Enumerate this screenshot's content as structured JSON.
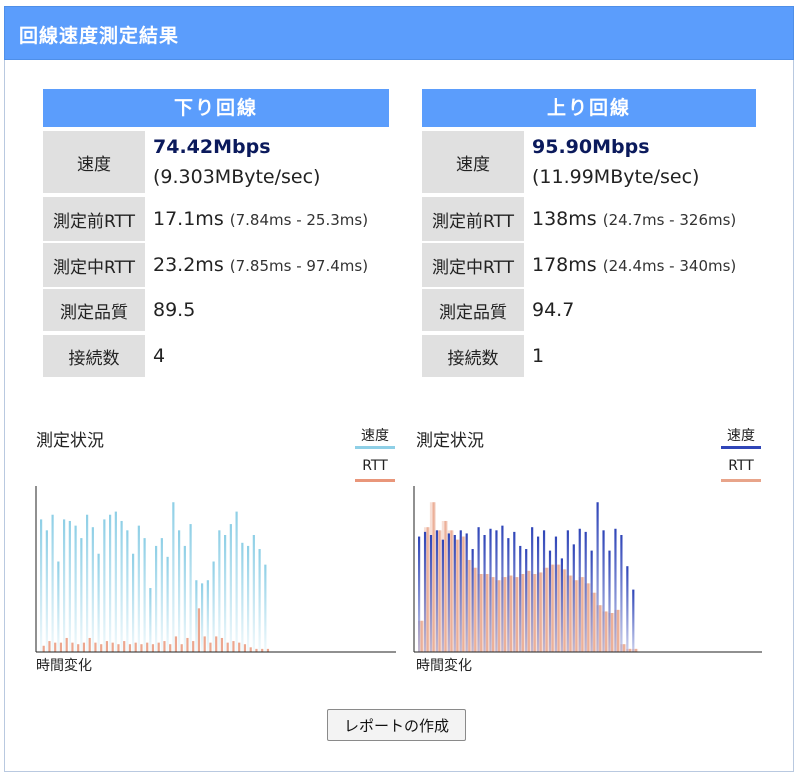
{
  "header": {
    "title": "回線速度測定結果"
  },
  "download": {
    "title": "下り回線",
    "speed_label": "速度",
    "speed_main": "74.42Mbps",
    "speed_sub": "(9.303MByte/sec)",
    "rtt_before_label": "測定前RTT",
    "rtt_before_value": "17.1ms",
    "rtt_before_range": "(7.84ms - 25.3ms)",
    "rtt_during_label": "測定中RTT",
    "rtt_during_value": "23.2ms",
    "rtt_during_range": "(7.85ms - 97.4ms)",
    "quality_label": "測定品質",
    "quality_value": "89.5",
    "connections_label": "接続数",
    "connections_value": "4"
  },
  "upload": {
    "title": "上り回線",
    "speed_label": "速度",
    "speed_main": "95.90Mbps",
    "speed_sub": "(11.99MByte/sec)",
    "rtt_before_label": "測定前RTT",
    "rtt_before_value": "138ms",
    "rtt_before_range": "(24.7ms - 326ms)",
    "rtt_during_label": "測定中RTT",
    "rtt_during_value": "178ms",
    "rtt_during_range": "(24.4ms - 340ms)",
    "quality_label": "測定品質",
    "quality_value": "94.7",
    "connections_label": "接続数",
    "connections_value": "1"
  },
  "charts": {
    "status_title": "測定状況",
    "legend_speed": "速度",
    "legend_rtt": "RTT",
    "x_label": "時間変化",
    "download_colors": {
      "speed": "#8ecfe6",
      "rtt": "#e9967a"
    },
    "upload_colors": {
      "speed": "#2f45b8",
      "rtt": "#e8a48a"
    }
  },
  "chart_data": [
    {
      "type": "bar",
      "xlabel": "時間変化",
      "ylim": [
        0,
        1
      ],
      "series": [
        {
          "name": "速度",
          "values": [
            0.85,
            0.78,
            0.88,
            0.58,
            0.85,
            0.84,
            0.81,
            0.73,
            0.88,
            0.8,
            0.63,
            0.85,
            0.88,
            0.9,
            0.84,
            0.78,
            0.63,
            0.81,
            0.73,
            0.41,
            0.68,
            0.73,
            0.61,
            0.96,
            0.78,
            0.68,
            0.82,
            0.46,
            0.44,
            0.46,
            0.58,
            0.78,
            0.75,
            0.82,
            0.9,
            0.7,
            0.68,
            0.75,
            0.66,
            0.56
          ]
        },
        {
          "name": "RTT",
          "values": [
            0.04,
            0.07,
            0.06,
            0.06,
            0.09,
            0.06,
            0.05,
            0.06,
            0.09,
            0.06,
            0.05,
            0.07,
            0.06,
            0.05,
            0.07,
            0.05,
            0.06,
            0.05,
            0.06,
            0.05,
            0.06,
            0.07,
            0.05,
            0.1,
            0.05,
            0.09,
            0.07,
            0.28,
            0.1,
            0.06,
            0.1,
            0.09,
            0.06,
            0.07,
            0.06,
            0.05,
            0.03,
            0.02,
            0.02,
            0.02
          ]
        }
      ]
    },
    {
      "type": "bar",
      "xlabel": "時間変化",
      "ylim": [
        0,
        1
      ],
      "series": [
        {
          "name": "速度",
          "values": [
            0.74,
            0.77,
            0.75,
            0.78,
            0.72,
            0.76,
            0.75,
            0.78,
            0.76,
            0.66,
            0.8,
            0.75,
            0.79,
            0.78,
            0.81,
            0.73,
            0.77,
            0.68,
            0.66,
            0.8,
            0.74,
            0.78,
            0.65,
            0.74,
            0.6,
            0.78,
            0.69,
            0.79,
            0.77,
            0.65,
            0.96,
            0.78,
            0.65,
            0.79,
            0.75,
            0.55,
            0.4
          ]
        },
        {
          "name": "RTT",
          "values": [
            0.2,
            0.8,
            0.96,
            0.78,
            0.84,
            0.78,
            0.72,
            0.74,
            0.59,
            0.54,
            0.5,
            0.5,
            0.48,
            0.46,
            0.48,
            0.49,
            0.48,
            0.5,
            0.52,
            0.5,
            0.51,
            0.54,
            0.56,
            0.56,
            0.53,
            0.49,
            0.46,
            0.48,
            0.44,
            0.38,
            0.3,
            0.26,
            0.25,
            0.27,
            0.05,
            0.02,
            0.02
          ]
        }
      ]
    }
  ],
  "report_button": {
    "label": "レポートの作成"
  }
}
